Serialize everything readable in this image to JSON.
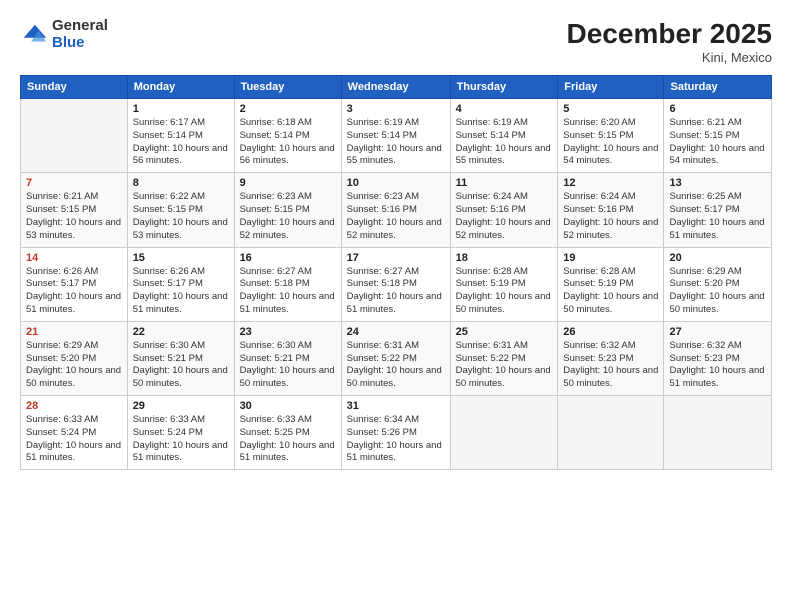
{
  "header": {
    "logo": {
      "general": "General",
      "blue": "Blue"
    },
    "title": "December 2025",
    "location": "Kini, Mexico"
  },
  "weekdays": [
    "Sunday",
    "Monday",
    "Tuesday",
    "Wednesday",
    "Thursday",
    "Friday",
    "Saturday"
  ],
  "weeks": [
    [
      {
        "day": "",
        "info": ""
      },
      {
        "day": "1",
        "info": "Sunrise: 6:17 AM\nSunset: 5:14 PM\nDaylight: 10 hours\nand 56 minutes."
      },
      {
        "day": "2",
        "info": "Sunrise: 6:18 AM\nSunset: 5:14 PM\nDaylight: 10 hours\nand 56 minutes."
      },
      {
        "day": "3",
        "info": "Sunrise: 6:19 AM\nSunset: 5:14 PM\nDaylight: 10 hours\nand 55 minutes."
      },
      {
        "day": "4",
        "info": "Sunrise: 6:19 AM\nSunset: 5:14 PM\nDaylight: 10 hours\nand 55 minutes."
      },
      {
        "day": "5",
        "info": "Sunrise: 6:20 AM\nSunset: 5:15 PM\nDaylight: 10 hours\nand 54 minutes."
      },
      {
        "day": "6",
        "info": "Sunrise: 6:21 AM\nSunset: 5:15 PM\nDaylight: 10 hours\nand 54 minutes."
      }
    ],
    [
      {
        "day": "7",
        "info": "Sunrise: 6:21 AM\nSunset: 5:15 PM\nDaylight: 10 hours\nand 53 minutes."
      },
      {
        "day": "8",
        "info": "Sunrise: 6:22 AM\nSunset: 5:15 PM\nDaylight: 10 hours\nand 53 minutes."
      },
      {
        "day": "9",
        "info": "Sunrise: 6:23 AM\nSunset: 5:15 PM\nDaylight: 10 hours\nand 52 minutes."
      },
      {
        "day": "10",
        "info": "Sunrise: 6:23 AM\nSunset: 5:16 PM\nDaylight: 10 hours\nand 52 minutes."
      },
      {
        "day": "11",
        "info": "Sunrise: 6:24 AM\nSunset: 5:16 PM\nDaylight: 10 hours\nand 52 minutes."
      },
      {
        "day": "12",
        "info": "Sunrise: 6:24 AM\nSunset: 5:16 PM\nDaylight: 10 hours\nand 52 minutes."
      },
      {
        "day": "13",
        "info": "Sunrise: 6:25 AM\nSunset: 5:17 PM\nDaylight: 10 hours\nand 51 minutes."
      }
    ],
    [
      {
        "day": "14",
        "info": "Sunrise: 6:26 AM\nSunset: 5:17 PM\nDaylight: 10 hours\nand 51 minutes."
      },
      {
        "day": "15",
        "info": "Sunrise: 6:26 AM\nSunset: 5:17 PM\nDaylight: 10 hours\nand 51 minutes."
      },
      {
        "day": "16",
        "info": "Sunrise: 6:27 AM\nSunset: 5:18 PM\nDaylight: 10 hours\nand 51 minutes."
      },
      {
        "day": "17",
        "info": "Sunrise: 6:27 AM\nSunset: 5:18 PM\nDaylight: 10 hours\nand 51 minutes."
      },
      {
        "day": "18",
        "info": "Sunrise: 6:28 AM\nSunset: 5:19 PM\nDaylight: 10 hours\nand 50 minutes."
      },
      {
        "day": "19",
        "info": "Sunrise: 6:28 AM\nSunset: 5:19 PM\nDaylight: 10 hours\nand 50 minutes."
      },
      {
        "day": "20",
        "info": "Sunrise: 6:29 AM\nSunset: 5:20 PM\nDaylight: 10 hours\nand 50 minutes."
      }
    ],
    [
      {
        "day": "21",
        "info": "Sunrise: 6:29 AM\nSunset: 5:20 PM\nDaylight: 10 hours\nand 50 minutes."
      },
      {
        "day": "22",
        "info": "Sunrise: 6:30 AM\nSunset: 5:21 PM\nDaylight: 10 hours\nand 50 minutes."
      },
      {
        "day": "23",
        "info": "Sunrise: 6:30 AM\nSunset: 5:21 PM\nDaylight: 10 hours\nand 50 minutes."
      },
      {
        "day": "24",
        "info": "Sunrise: 6:31 AM\nSunset: 5:22 PM\nDaylight: 10 hours\nand 50 minutes."
      },
      {
        "day": "25",
        "info": "Sunrise: 6:31 AM\nSunset: 5:22 PM\nDaylight: 10 hours\nand 50 minutes."
      },
      {
        "day": "26",
        "info": "Sunrise: 6:32 AM\nSunset: 5:23 PM\nDaylight: 10 hours\nand 50 minutes."
      },
      {
        "day": "27",
        "info": "Sunrise: 6:32 AM\nSunset: 5:23 PM\nDaylight: 10 hours\nand 51 minutes."
      }
    ],
    [
      {
        "day": "28",
        "info": "Sunrise: 6:33 AM\nSunset: 5:24 PM\nDaylight: 10 hours\nand 51 minutes."
      },
      {
        "day": "29",
        "info": "Sunrise: 6:33 AM\nSunset: 5:24 PM\nDaylight: 10 hours\nand 51 minutes."
      },
      {
        "day": "30",
        "info": "Sunrise: 6:33 AM\nSunset: 5:25 PM\nDaylight: 10 hours\nand 51 minutes."
      },
      {
        "day": "31",
        "info": "Sunrise: 6:34 AM\nSunset: 5:26 PM\nDaylight: 10 hours\nand 51 minutes."
      },
      {
        "day": "",
        "info": ""
      },
      {
        "day": "",
        "info": ""
      },
      {
        "day": "",
        "info": ""
      }
    ]
  ]
}
